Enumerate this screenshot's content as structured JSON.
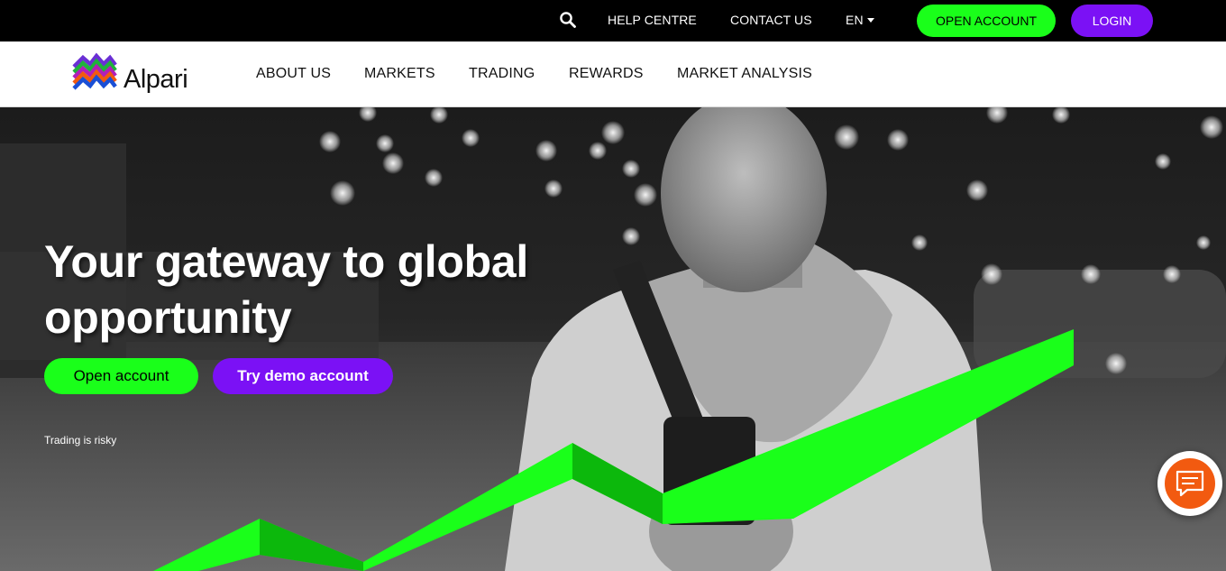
{
  "topbar": {
    "search_icon": "search-icon",
    "help_label": "HELP CENTRE",
    "contact_label": "CONTACT US",
    "lang_label": "EN",
    "open_account_label": "OPEN ACCOUNT",
    "login_label": "LOGIN"
  },
  "brand": {
    "name": "Alpari",
    "logo_icon": "alpari-logo-icon"
  },
  "nav": {
    "items": [
      {
        "label": "ABOUT US"
      },
      {
        "label": "MARKETS"
      },
      {
        "label": "TRADING"
      },
      {
        "label": "REWARDS"
      },
      {
        "label": "MARKET ANALYSIS"
      }
    ]
  },
  "hero": {
    "title_line1": "Your gateway to global",
    "title_line2": "opportunity",
    "open_account_label": "Open account",
    "demo_label": "Try demo account",
    "risk_text": "Trading is risky",
    "chat_icon": "chat-bubble-icon"
  },
  "colors": {
    "accent_green": "#1aff1a",
    "accent_purple": "#7b11f5",
    "chat_orange": "#f25a10",
    "topbar_bg": "#000000"
  }
}
